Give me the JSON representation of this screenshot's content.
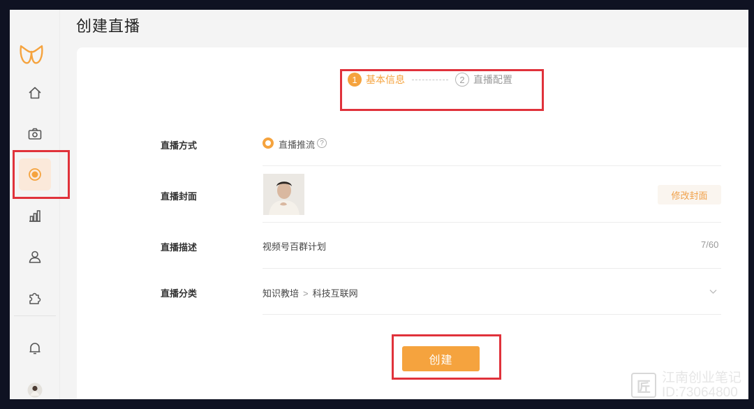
{
  "page": {
    "title": "创建直播"
  },
  "sidebar": {
    "items": [
      {
        "name": "home",
        "icon": "home-icon"
      },
      {
        "name": "camera",
        "icon": "camera-icon"
      },
      {
        "name": "live",
        "icon": "live-record-icon",
        "active": true
      },
      {
        "name": "stats",
        "icon": "bar-chart-icon"
      },
      {
        "name": "users",
        "icon": "user-icon"
      },
      {
        "name": "plugins",
        "icon": "puzzle-icon"
      },
      {
        "name": "notifications",
        "icon": "bell-icon"
      },
      {
        "name": "profile",
        "icon": "avatar-icon"
      }
    ]
  },
  "steps": [
    {
      "num": "1",
      "label": "基本信息",
      "active": true
    },
    {
      "num": "2",
      "label": "直播配置",
      "active": false
    }
  ],
  "form": {
    "mode": {
      "label": "直播方式",
      "option": "直播推流",
      "help": "?"
    },
    "cover": {
      "label": "直播封面",
      "button": "修改封面"
    },
    "description": {
      "label": "直播描述",
      "value": "视频号百群计划",
      "count": "7/60"
    },
    "category": {
      "label": "直播分类",
      "primary": "知识教培",
      "separator": ">",
      "secondary": "科技互联网"
    }
  },
  "create_button": "创建",
  "watermark": {
    "logo": "匠",
    "line1": "江南创业笔记",
    "line2": "ID:73064800"
  },
  "colors": {
    "accent": "#f5a33e",
    "highlight_box": "#e0323b"
  }
}
